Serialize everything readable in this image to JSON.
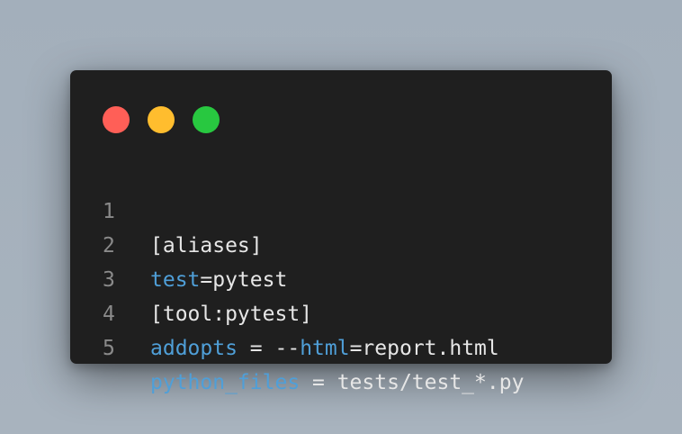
{
  "window": {
    "traffic_lights": [
      {
        "name": "close",
        "color": "#ff5f57"
      },
      {
        "name": "minimize",
        "color": "#ffbd2e"
      },
      {
        "name": "maximize",
        "color": "#28c840"
      }
    ]
  },
  "code": {
    "colors": {
      "plain": "#e6e6e6",
      "key": "#4f9fd8",
      "line_number": "#8a8a8a"
    },
    "lines": [
      {
        "number": "1",
        "tokens": [
          {
            "text": "[aliases]",
            "kind": "plain"
          }
        ]
      },
      {
        "number": "2",
        "tokens": [
          {
            "text": "test",
            "kind": "key"
          },
          {
            "text": "=pytest",
            "kind": "plain"
          }
        ]
      },
      {
        "number": "3",
        "tokens": [
          {
            "text": "[tool:pytest]",
            "kind": "plain"
          }
        ]
      },
      {
        "number": "4",
        "tokens": [
          {
            "text": "addopts",
            "kind": "key"
          },
          {
            "text": " = --",
            "kind": "plain"
          },
          {
            "text": "html",
            "kind": "key"
          },
          {
            "text": "=report.html",
            "kind": "plain"
          }
        ]
      },
      {
        "number": "5",
        "tokens": [
          {
            "text": "python_files",
            "kind": "key"
          },
          {
            "text": " = tests/test_*.py",
            "kind": "plain"
          }
        ]
      }
    ]
  }
}
